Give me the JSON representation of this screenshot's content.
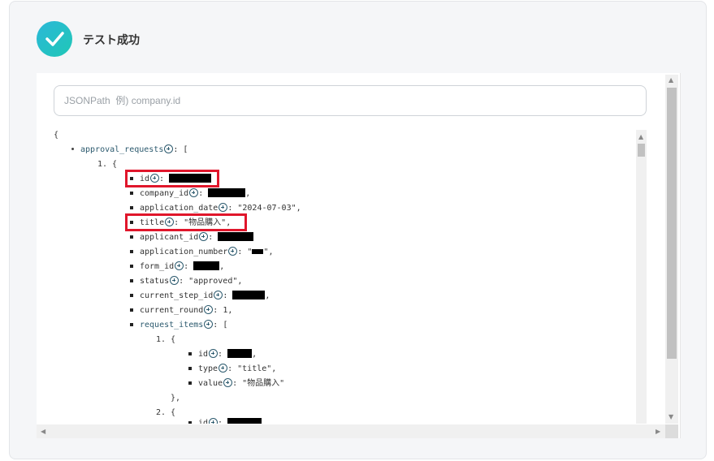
{
  "header": {
    "title": "テスト成功",
    "icon": "check-circle-icon",
    "icon_color": "#20c0c6"
  },
  "search": {
    "placeholder": "JSONPath  例) company.id",
    "value": ""
  },
  "json_tree": {
    "open_brace": "{",
    "root_key": "approval_requests",
    "root_open": ": [",
    "item1_num": "1. {",
    "id_key": "id",
    "company_id_key": "company_id",
    "application_date_key": "application_date",
    "application_date_value": ": \"2024-07-03\",",
    "title_key": "title",
    "title_value": ": \"物品購入\",",
    "applicant_id_key": "applicant_id",
    "application_number_key": "application_number",
    "form_id_key": "form_id",
    "status_key": "status",
    "status_value": ": \"approved\",",
    "current_step_id_key": "current_step_id",
    "current_round_key": "current_round",
    "current_round_value": ": 1,",
    "request_items_key": "request_items",
    "request_items_open": ": [",
    "sub1_num": "1. {",
    "sub1_id_key": "id",
    "sub1_type_key": "type",
    "sub1_type_value": ": \"title\",",
    "sub1_value_key": "value",
    "sub1_value_value": ": \"物品購入\"",
    "sub1_close": "},",
    "sub2_num": "2. {",
    "sub2_id_key": "id"
  },
  "colors": {
    "highlight": "#e0162b",
    "key": "#2c5a6e"
  }
}
